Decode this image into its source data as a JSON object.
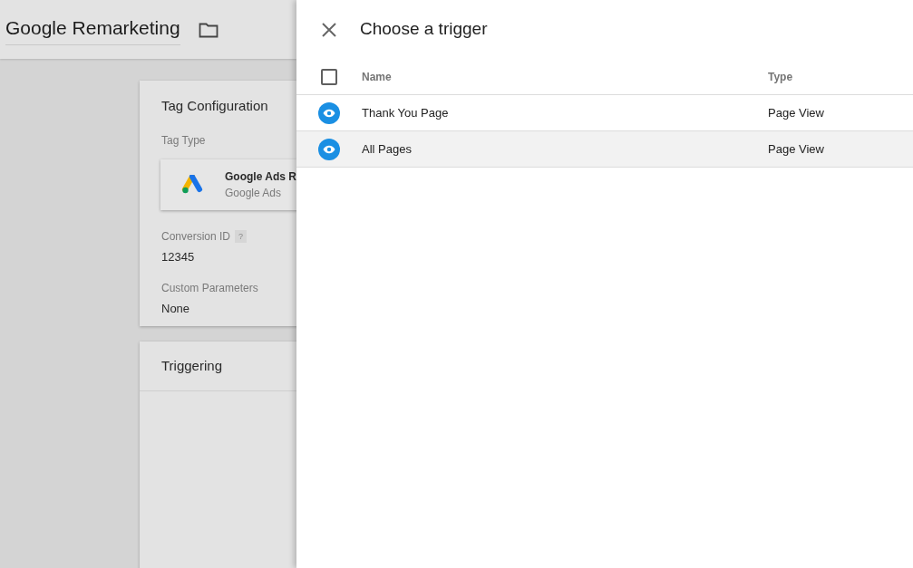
{
  "header": {
    "title": "Google Remarketing"
  },
  "tag_configuration": {
    "title": "Tag Configuration",
    "tag_type_label": "Tag Type",
    "tag_type": {
      "name": "Google Ads R",
      "vendor": "Google Ads"
    },
    "fields": [
      {
        "label": "Conversion ID",
        "help": "?",
        "value": "12345"
      },
      {
        "label": "Custom Parameters",
        "value": "None"
      }
    ]
  },
  "triggering": {
    "title": "Triggering"
  },
  "drawer": {
    "title": "Choose a trigger",
    "select_all_checked": false,
    "columns": [
      "Name",
      "Type"
    ],
    "rows": [
      {
        "name": "Thank You Page",
        "type": "Page View",
        "selected": false
      },
      {
        "name": "All Pages",
        "type": "Page View",
        "selected": true
      }
    ]
  }
}
